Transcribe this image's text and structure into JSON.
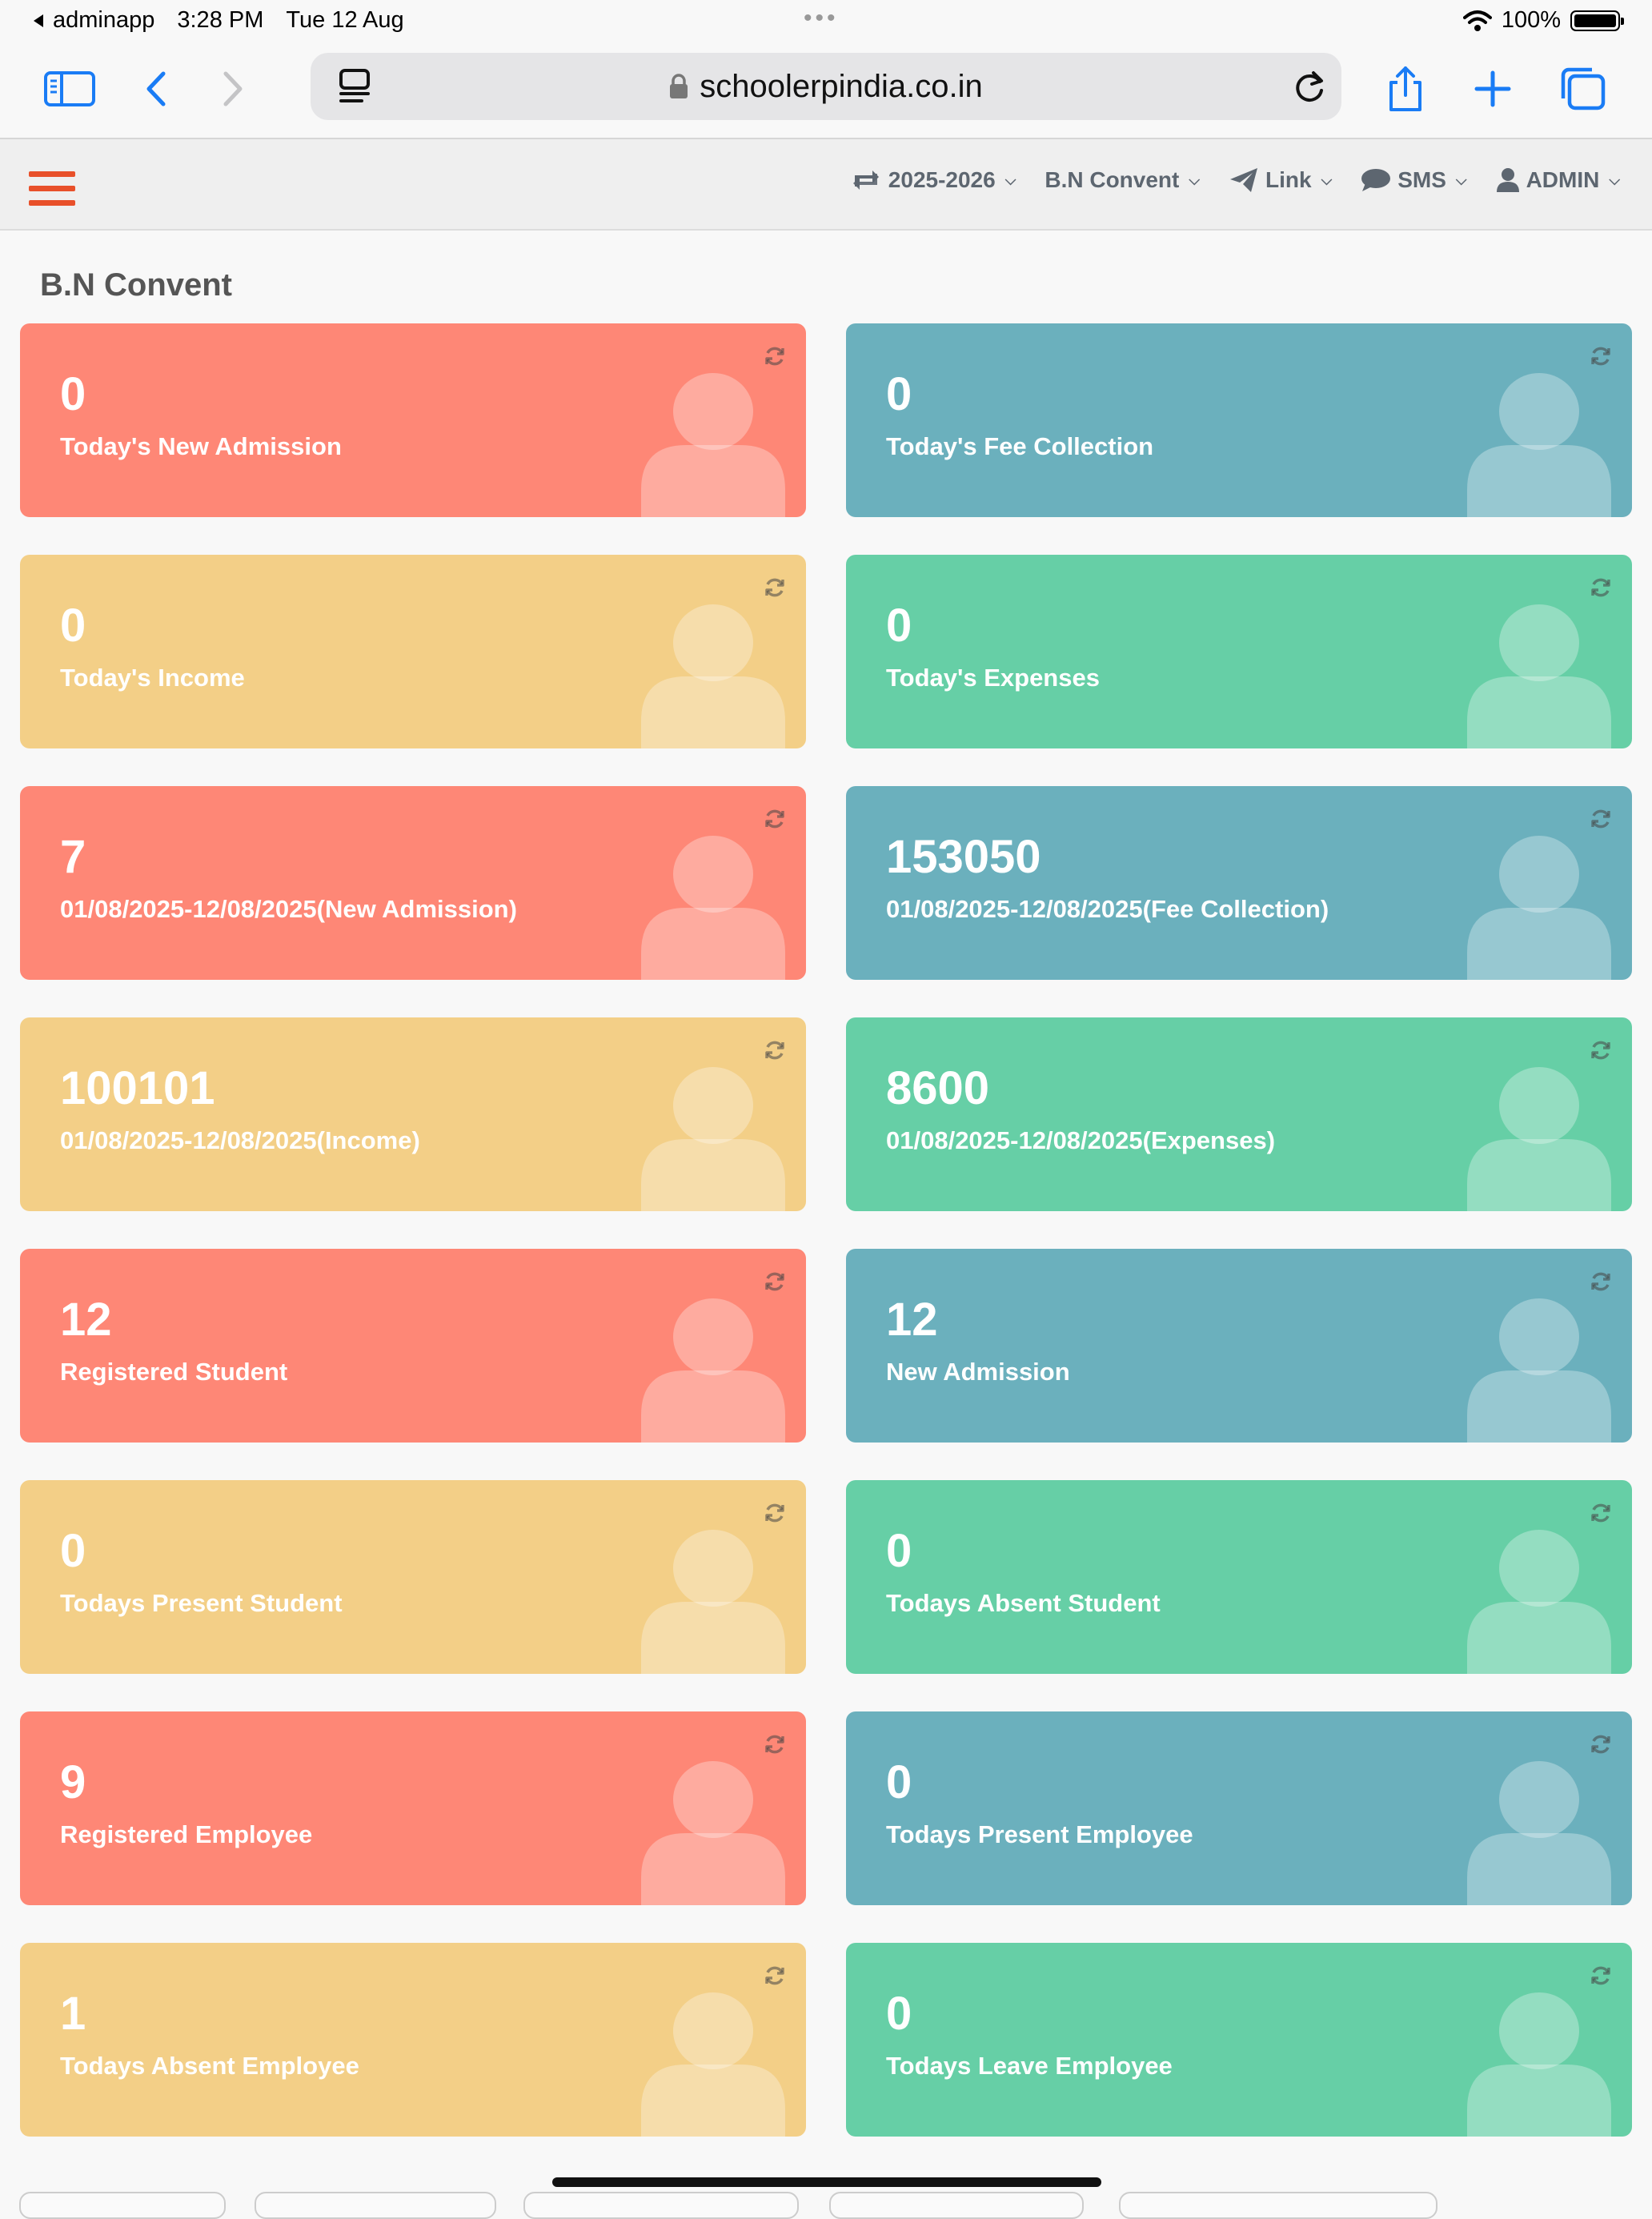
{
  "status_bar": {
    "back_app": "adminapp",
    "time": "3:28 PM",
    "date": "Tue 12 Aug",
    "battery": "100%"
  },
  "browser": {
    "url": "schoolerpindia.co.in"
  },
  "navbar": {
    "session": "2025-2026",
    "school": "B.N Convent",
    "link": "Link",
    "sms": "SMS",
    "user": "ADMIN"
  },
  "page": {
    "title": "B.N Convent"
  },
  "colors": {
    "red": "#fe8776",
    "blue": "#6bb0bd",
    "yellow": "#f3cf87",
    "green": "#66cfa6",
    "hamburger": "#e8502a"
  },
  "cards": [
    {
      "value": "0",
      "label": "Today's New Admission",
      "color": "red"
    },
    {
      "value": "0",
      "label": "Today's Fee Collection",
      "color": "blue"
    },
    {
      "value": "0",
      "label": "Today's Income",
      "color": "yellow"
    },
    {
      "value": "0",
      "label": "Today's Expenses",
      "color": "green"
    },
    {
      "value": "7",
      "label": "01/08/2025-12/08/2025(New Admission)",
      "color": "red"
    },
    {
      "value": "153050",
      "label": "01/08/2025-12/08/2025(Fee Collection)",
      "color": "blue"
    },
    {
      "value": "100101",
      "label": "01/08/2025-12/08/2025(Income)",
      "color": "yellow"
    },
    {
      "value": "8600",
      "label": "01/08/2025-12/08/2025(Expenses)",
      "color": "green"
    },
    {
      "value": "12",
      "label": "Registered Student",
      "color": "red"
    },
    {
      "value": "12",
      "label": "New Admission",
      "color": "blue"
    },
    {
      "value": "0",
      "label": "Todays Present Student",
      "color": "yellow"
    },
    {
      "value": "0",
      "label": "Todays Absent Student",
      "color": "green"
    },
    {
      "value": "9",
      "label": "Registered Employee",
      "color": "red"
    },
    {
      "value": "0",
      "label": "Todays Present Employee",
      "color": "blue"
    },
    {
      "value": "1",
      "label": "Todays Absent Employee",
      "color": "yellow"
    },
    {
      "value": "0",
      "label": "Todays Leave Employee",
      "color": "green"
    }
  ]
}
